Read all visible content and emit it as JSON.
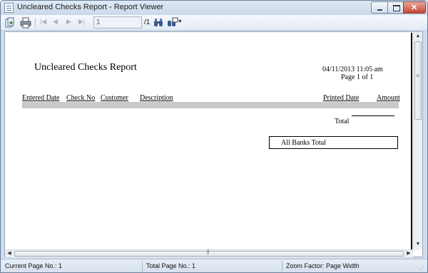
{
  "window": {
    "title": "Uncleared Checks Report -  Report Viewer"
  },
  "toolbar": {
    "page_input_value": "1",
    "page_total": "/1",
    "icons": [
      "export-icon",
      "print-icon",
      "first-page-icon",
      "previous-page-icon",
      "next-page-icon",
      "last-page-icon",
      "find-icon",
      "zoom-icon"
    ]
  },
  "report": {
    "title": "Uncleared Checks Report",
    "date_time": "04/11/2013   11:05 am",
    "page_info": "Page 1 of 1",
    "columns": [
      "Entered Date",
      "Check No",
      "Customer",
      "Description",
      "Printed Date",
      "Amount"
    ],
    "total_label": "Total",
    "all_banks_total_label": "All Banks Total"
  },
  "statusbar": {
    "current_page": "Current Page No.: 1",
    "total_page": "Total Page No.: 1",
    "zoom_factor": "Zoom Factor: Page Width"
  },
  "colors": {
    "title_bar": "#cfdcec",
    "close_button": "#c7453a",
    "header_band": "#c8c8c8"
  }
}
